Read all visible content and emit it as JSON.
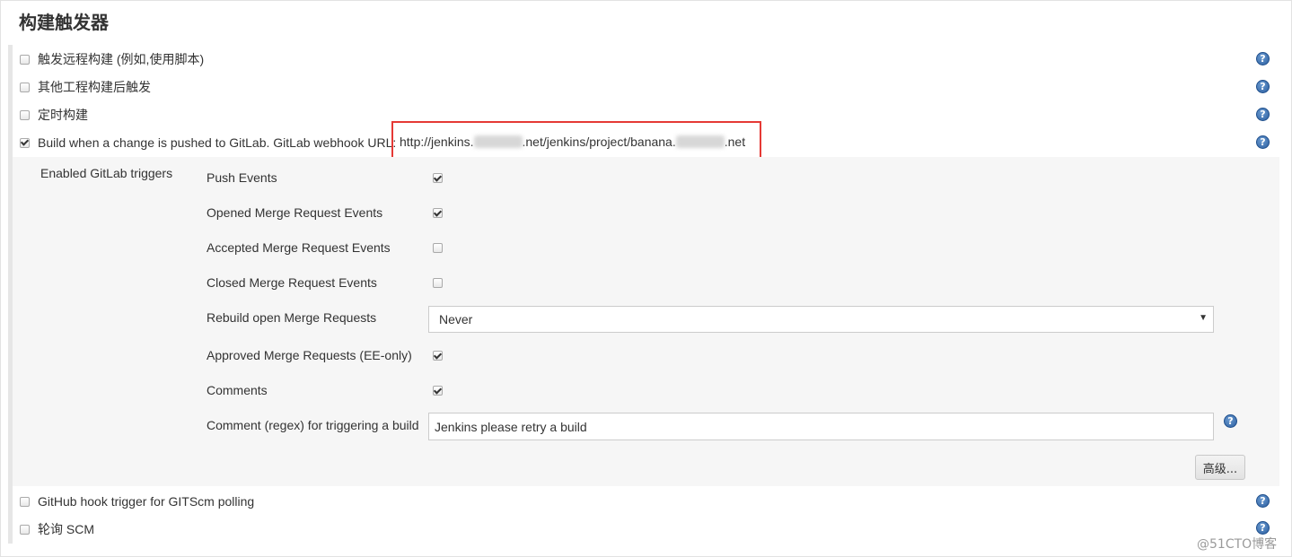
{
  "section_title": "构建触发器",
  "triggers": [
    {
      "label": "触发远程构建 (例如,使用脚本)",
      "checked": false
    },
    {
      "label": "其他工程构建后触发",
      "checked": false
    },
    {
      "label": "定时构建",
      "checked": false
    },
    {
      "label": "Build when a change is pushed to GitLab. GitLab webhook URL:",
      "checked": true
    }
  ],
  "webhook_url": {
    "part1": "http://jenkins.",
    "part2": ".net/jenkins/project/banana.",
    "part3": ".net"
  },
  "gitlab": {
    "enabled_label": "Enabled GitLab triggers",
    "options": [
      {
        "label": "Push Events",
        "checked": true
      },
      {
        "label": "Opened Merge Request Events",
        "checked": true
      },
      {
        "label": "Accepted Merge Request Events",
        "checked": false
      },
      {
        "label": "Closed Merge Request Events",
        "checked": false
      },
      {
        "label": "Rebuild open Merge Requests",
        "value": "Never"
      },
      {
        "label": "Approved Merge Requests (EE-only)",
        "checked": true
      },
      {
        "label": "Comments",
        "checked": true
      },
      {
        "label": "Comment (regex) for triggering a build",
        "value": "Jenkins please retry a build"
      }
    ],
    "advanced_button": "高级..."
  },
  "other_triggers": [
    {
      "label": "GitHub hook trigger for GITScm polling",
      "checked": false
    },
    {
      "label": "轮询 SCM",
      "checked": false
    }
  ],
  "watermark": "@51CTO博客",
  "colors": {
    "highlight_box": "#e53935",
    "help_icon": "#2c5fa0",
    "panel_bg": "#f6f6f6"
  }
}
